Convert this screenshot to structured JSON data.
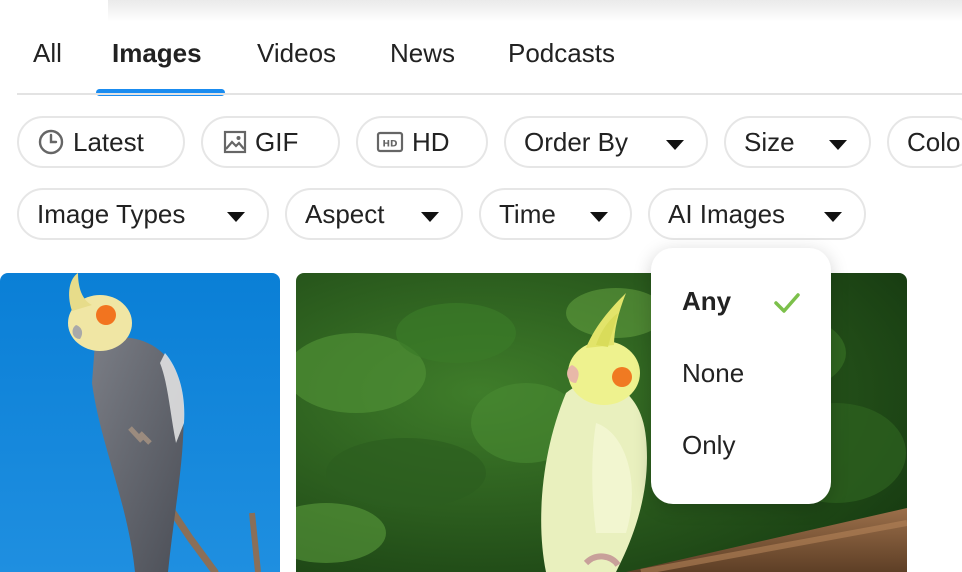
{
  "tabs": [
    {
      "label": "All"
    },
    {
      "label": "Images"
    },
    {
      "label": "Videos"
    },
    {
      "label": "News"
    },
    {
      "label": "Podcasts"
    }
  ],
  "active_tab": "Images",
  "filters_row1": {
    "latest": {
      "label": "Latest",
      "icon": "clock-icon"
    },
    "gif": {
      "label": "GIF",
      "icon": "image-icon"
    },
    "hd": {
      "label": "HD",
      "icon": "hd-icon"
    },
    "order_by": {
      "label": "Order By"
    },
    "size": {
      "label": "Size"
    },
    "color": {
      "label": "Colo"
    }
  },
  "filters_row2": {
    "image_types": {
      "label": "Image Types"
    },
    "aspect": {
      "label": "Aspect"
    },
    "time": {
      "label": "Time"
    },
    "ai_images": {
      "label": "AI Images"
    }
  },
  "ai_images_menu": {
    "options": [
      {
        "label": "Any"
      },
      {
        "label": "None"
      },
      {
        "label": "Only"
      }
    ],
    "selected": "Any"
  },
  "colors": {
    "accent": "#1a8cf0",
    "check": "#7cc04b"
  }
}
